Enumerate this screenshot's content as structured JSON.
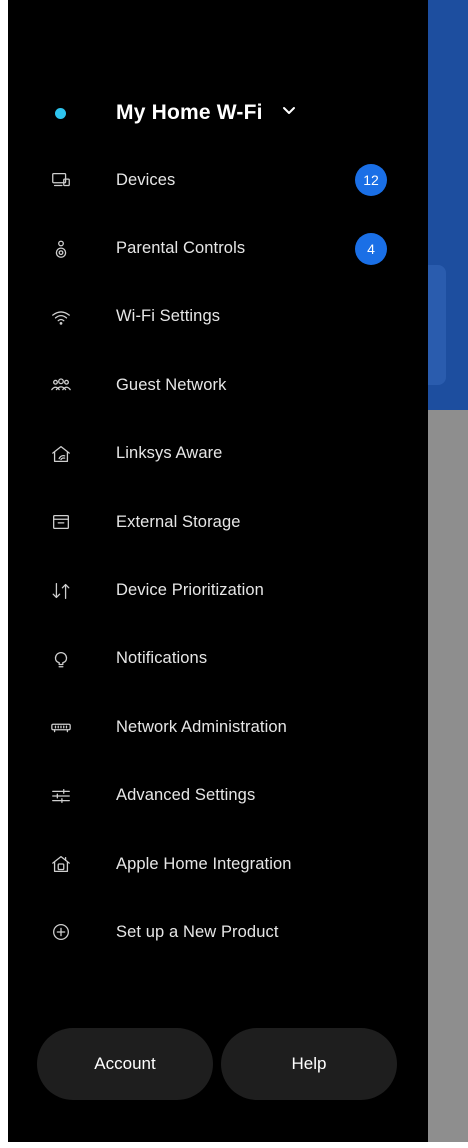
{
  "network": {
    "name": "My Home W-Fi",
    "status_color": "#2ec4ee"
  },
  "menu": [
    {
      "label": "Devices",
      "icon": "devices-icon",
      "badge": "12"
    },
    {
      "label": "Parental Controls",
      "icon": "parental-controls-icon",
      "badge": "4"
    },
    {
      "label": "Wi-Fi Settings",
      "icon": "wifi-icon"
    },
    {
      "label": "Guest Network",
      "icon": "guest-network-icon"
    },
    {
      "label": "Linksys Aware",
      "icon": "linksys-aware-icon"
    },
    {
      "label": "External Storage",
      "icon": "external-storage-icon"
    },
    {
      "label": "Device Prioritization",
      "icon": "prioritization-icon"
    },
    {
      "label": "Notifications",
      "icon": "notifications-icon"
    },
    {
      "label": "Network Administration",
      "icon": "router-icon"
    },
    {
      "label": "Advanced Settings",
      "icon": "sliders-icon"
    },
    {
      "label": "Apple Home Integration",
      "icon": "apple-home-icon"
    },
    {
      "label": "Set up a New Product",
      "icon": "plus-circle-icon"
    }
  ],
  "buttons": {
    "account": "Account",
    "help": "Help"
  },
  "colors": {
    "drawer_bg": "#000000",
    "badge_bg": "#1a6fe6",
    "backdrop_blue": "#1d4e9f",
    "backdrop_grey": "#8e8e8e"
  }
}
